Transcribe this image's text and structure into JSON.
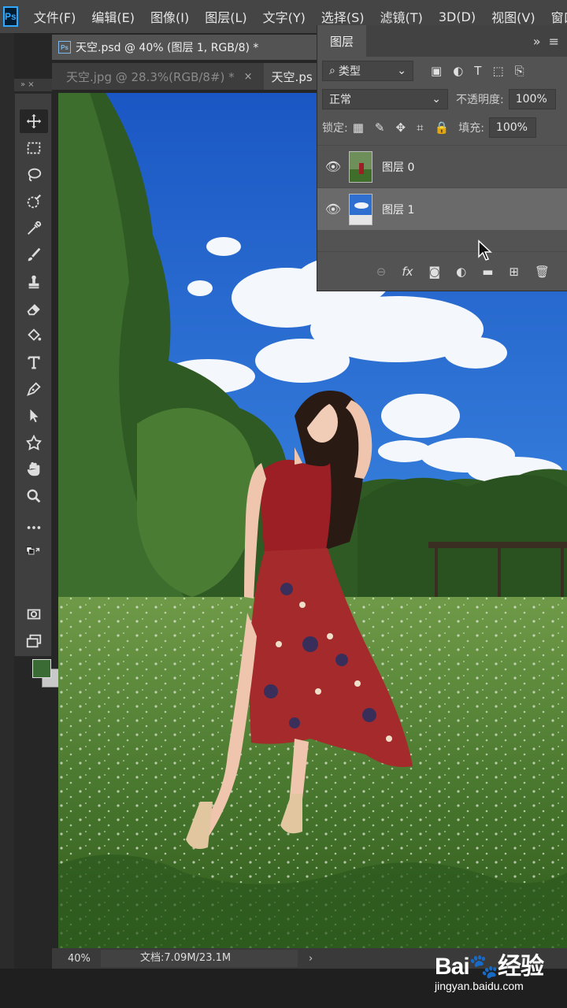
{
  "app": {
    "logo": "Ps"
  },
  "menu": [
    "文件(F)",
    "编辑(E)",
    "图像(I)",
    "图层(L)",
    "文字(Y)",
    "选择(S)",
    "滤镜(T)",
    "3D(D)",
    "视图(V)",
    "窗口"
  ],
  "tabs": {
    "active_doc": "天空.psd @ 40% (图层 1, RGB/8) *",
    "doc2": "天空.jpg @ 28.3%(RGB/8#) *",
    "doc2_close": "×",
    "doc3": "天空.ps"
  },
  "toolbar": {
    "header": "»  ×",
    "tools": [
      "move-tool",
      "marquee-tool",
      "lasso-tool",
      "quick-select-tool",
      "eyedropper-tool",
      "brush-tool",
      "stamp-tool",
      "eraser-tool",
      "paint-bucket-tool",
      "type-tool",
      "pen-tool",
      "path-select-tool",
      "shape-tool",
      "hand-tool",
      "zoom-tool",
      "more-tools"
    ],
    "foreground_color": "#3b6b34",
    "background_color": "#c9c9c9"
  },
  "layers_panel": {
    "title": "图层",
    "kind_filter": "类型",
    "blend_mode": "正常",
    "opacity_label": "不透明度:",
    "opacity_value": "100%",
    "lock_label": "锁定:",
    "fill_label": "填充:",
    "fill_value": "100%",
    "layers": [
      {
        "name": "图层 0",
        "visible": true,
        "selected": false
      },
      {
        "name": "图层 1",
        "visible": true,
        "selected": true
      }
    ],
    "footer_icons": [
      "link-icon",
      "fx-icon",
      "mask-icon",
      "adjustment-icon",
      "folder-icon",
      "new-layer-icon",
      "trash-icon"
    ]
  },
  "status": {
    "zoom": "40%",
    "doc_info": "文档:7.09M/23.1M",
    "arrow": "›"
  },
  "watermark": {
    "logo": "Bai🐾经验",
    "url": "jingyan.baidu.com"
  }
}
